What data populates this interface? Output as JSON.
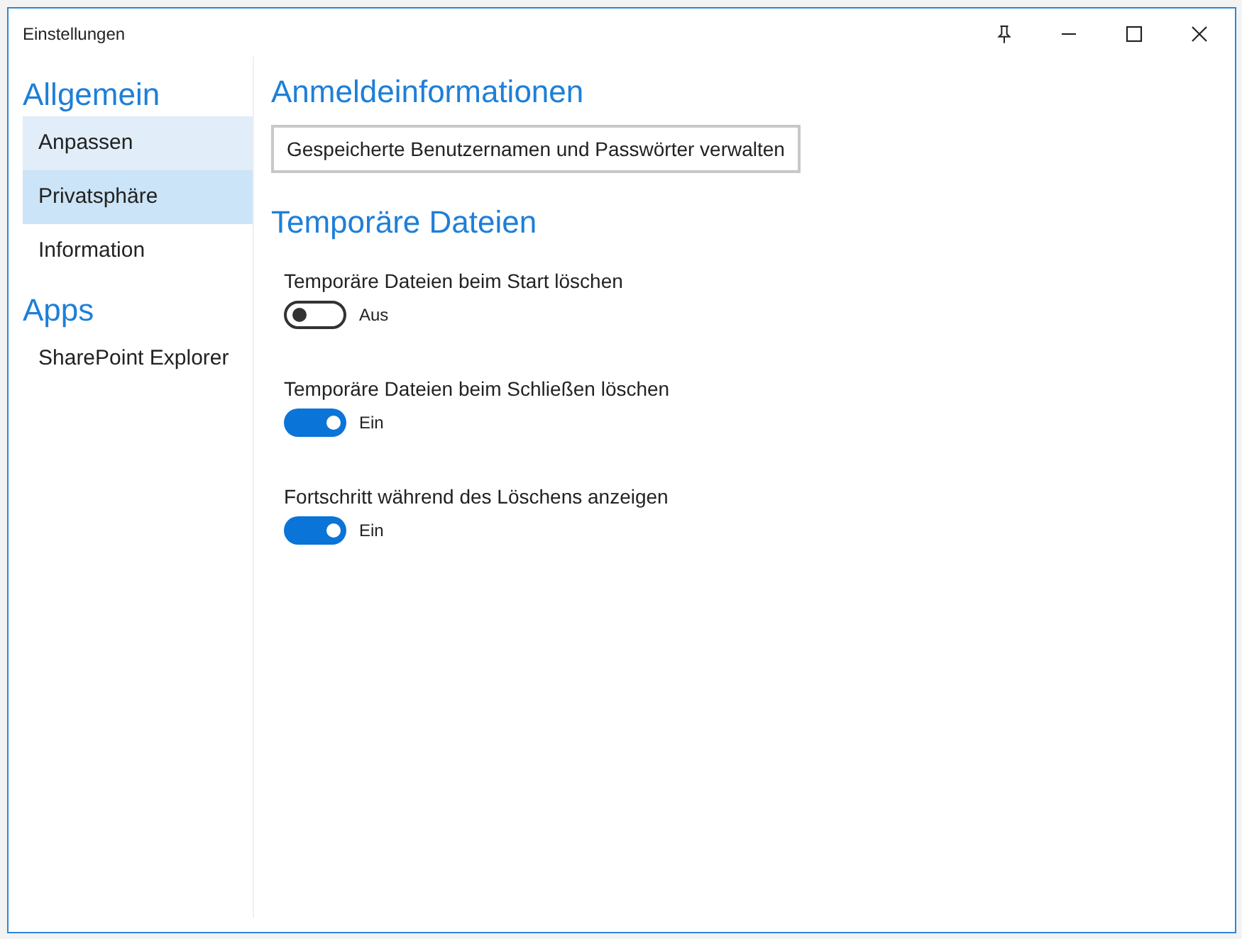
{
  "window": {
    "title": "Einstellungen",
    "controls": [
      {
        "kind": "pin"
      },
      {
        "kind": "minimize"
      },
      {
        "kind": "maximize"
      },
      {
        "kind": "close"
      }
    ]
  },
  "sidebar": {
    "groups": [
      {
        "heading": "Allgemein",
        "items": [
          {
            "label": "Anpassen",
            "selected": false,
            "hovered": true
          },
          {
            "label": "Privatsphäre",
            "selected": true,
            "hovered": false
          },
          {
            "label": "Information",
            "selected": false,
            "hovered": false
          }
        ]
      },
      {
        "heading": "Apps",
        "items": [
          {
            "label": "SharePoint Explorer",
            "selected": false,
            "hovered": false
          }
        ]
      }
    ]
  },
  "sections": [
    {
      "heading": "Anmeldeinformationen",
      "button": "Gespeicherte Benutzernamen und Passwörter verwalten"
    },
    {
      "heading": "Temporäre Dateien",
      "toggles": [
        {
          "label": "Temporäre Dateien beim Start löschen",
          "on": false,
          "state_text": "Aus"
        },
        {
          "label": "Temporäre Dateien beim Schließen löschen",
          "on": true,
          "state_text": "Ein"
        },
        {
          "label": "Fortschritt während des Löschens anzeigen",
          "on": true,
          "state_text": "Ein"
        }
      ]
    }
  ]
}
